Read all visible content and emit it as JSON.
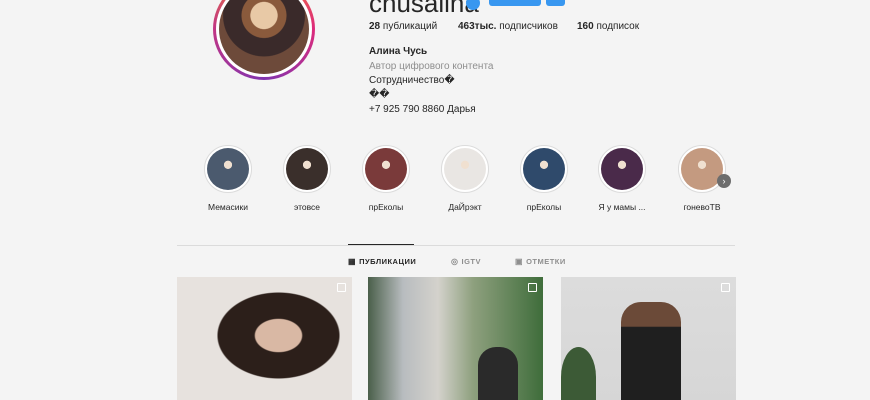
{
  "profile": {
    "username": "chusalina",
    "posts_count": "28",
    "posts_label": "публикаций",
    "followers_count": "463тыс.",
    "followers_label": "подписчиков",
    "following_count": "160",
    "following_label": "подписок",
    "full_name": "Алина Чусь",
    "category": "Автор цифрового контента",
    "bio_line1": "Сотрудничество�",
    "bio_line2": "��",
    "bio_line3": "+7 925 790 8860 Дарья"
  },
  "highlights": [
    {
      "label": "Мемасики",
      "color": "#4b5a6e"
    },
    {
      "label": "этовсе",
      "color": "#3a2f2b"
    },
    {
      "label": "прЕколы",
      "color": "#7a3a3a"
    },
    {
      "label": "ДаЙрэкт",
      "color": "#e9e6e3"
    },
    {
      "label": "прЕколы",
      "color": "#2f4a6b"
    },
    {
      "label": "Я у мамы ...",
      "color": "#4a2a4a"
    },
    {
      "label": "гоневоТВ",
      "color": "#c49a80"
    }
  ],
  "tabs": {
    "posts": "ПУБЛИКАЦИИ",
    "igtv": "IGTV",
    "tagged": "ОТМЕТКИ"
  }
}
